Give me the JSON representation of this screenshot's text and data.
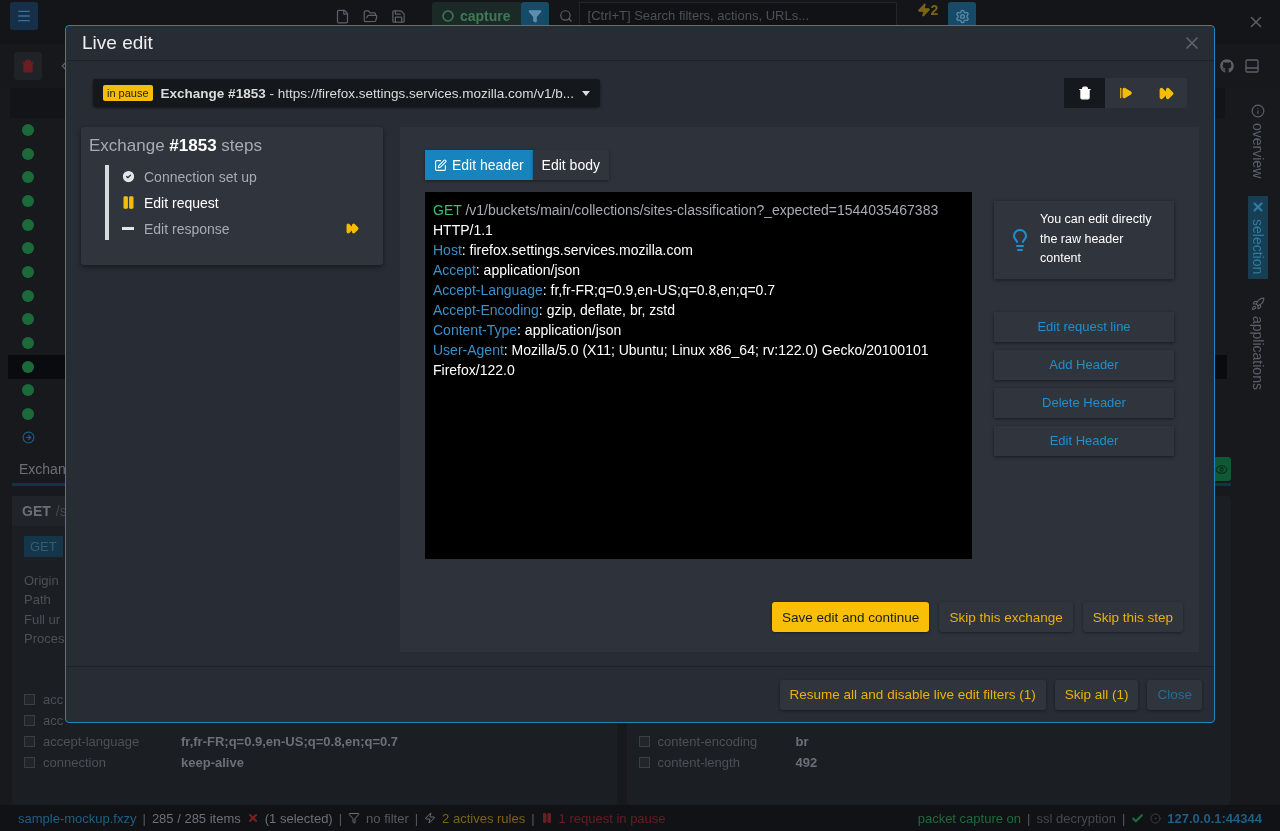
{
  "toolbar": {
    "capture_label": "capture",
    "search_placeholder": "[Ctrl+T] Search filters, actions, URLs...",
    "rules_count": "2"
  },
  "exchange_list": [
    {
      "kind": "dot",
      "selected": false
    },
    {
      "kind": "dot",
      "selected": false
    },
    {
      "kind": "dot",
      "selected": false
    },
    {
      "kind": "dot",
      "selected": false
    },
    {
      "kind": "dot",
      "selected": false
    },
    {
      "kind": "dot",
      "selected": false
    },
    {
      "kind": "dot",
      "selected": false
    },
    {
      "kind": "dot",
      "selected": false
    },
    {
      "kind": "dot",
      "selected": false
    },
    {
      "kind": "dot",
      "selected": false
    },
    {
      "kind": "dot",
      "selected": true
    },
    {
      "kind": "dot",
      "selected": false
    },
    {
      "kind": "dot",
      "selected": false
    },
    {
      "kind": "arrow",
      "selected": false
    }
  ],
  "detail_panel": {
    "tab": "Exchan",
    "summary_method": "GET",
    "summary_path": "/s",
    "method_badge": "GET",
    "labels": [
      "Origin",
      "Path",
      "Full ur",
      "Proces"
    ],
    "headers": [
      {
        "name": "acc",
        "checked": false
      },
      {
        "name": "acc",
        "checked": false
      },
      {
        "name": "accept-language",
        "value": "fr,fr-FR;q=0.9,en-US;q=0.8,en;q=0.7",
        "checked": false
      },
      {
        "name": "connection",
        "value": "keep-alive",
        "checked": false
      }
    ]
  },
  "response_panel": {
    "headers": [
      {
        "name": "content-encoding",
        "value": "br",
        "checked": false
      },
      {
        "name": "content-length",
        "value": "492",
        "checked": false
      }
    ]
  },
  "side_tabs": [
    {
      "label": "overview",
      "kind": "info",
      "selected": false
    },
    {
      "label": "selection",
      "kind": "cross",
      "selected": true
    },
    {
      "label": "applications",
      "kind": "rocket",
      "selected": false
    }
  ],
  "status_bar": {
    "separator": "|",
    "left": [
      {
        "kind": "file",
        "text": "sample-mockup.fxzy"
      },
      {
        "kind": "items",
        "text": "285 / 285 items"
      },
      {
        "kind": "selection",
        "text": "(1 selected)"
      },
      {
        "kind": "filter",
        "text": "no filter"
      },
      {
        "kind": "rules",
        "text": "2 actives rules"
      },
      {
        "kind": "pause",
        "text": "1 request in pause"
      }
    ],
    "right": [
      {
        "kind": "capture",
        "text": "packet capture on"
      },
      {
        "kind": "ssl",
        "text": "ssl decryption"
      },
      {
        "kind": "proxy",
        "text": "127.0.0.1:44344"
      }
    ]
  },
  "live_edit": {
    "title": "Live edit",
    "exchange_select": {
      "badge": "in pause",
      "label": "**Exchange #1853** - https://firefox.settings.services.mozilla.com/v1/b..."
    },
    "actions": [
      {
        "kind": "delete"
      },
      {
        "kind": "step"
      },
      {
        "kind": "resume"
      }
    ],
    "steps_title": "Exchange **#1853** steps",
    "steps": [
      {
        "label": "Connection set up",
        "kind": "done",
        "skip_marker": false
      },
      {
        "label": "Edit request",
        "kind": "paused",
        "skip_marker": false
      },
      {
        "label": "Edit response",
        "kind": "pending",
        "skip_marker": true
      }
    ],
    "header_separator": ":",
    "editor_tabs": [
      {
        "label": "Edit header",
        "selected": true
      },
      {
        "label": "Edit body",
        "selected": false
      }
    ],
    "request_line": {
      "method": "GET",
      "target": "/v1/buckets/main/collections/sites-classification?_expected=1544035467383",
      "version": "HTTP/1.1"
    },
    "headers": [
      {
        "name": "Host",
        "value": "firefox.settings.services.mozilla.com"
      },
      {
        "name": "Accept",
        "value": "application/json"
      },
      {
        "name": "Accept-Language",
        "value": "fr,fr-FR;q=0.9,en-US;q=0.8,en;q=0.7"
      },
      {
        "name": "Accept-Encoding",
        "value": "gzip, deflate, br, zstd"
      },
      {
        "name": "Content-Type",
        "value": "application/json"
      },
      {
        "name": "User-Agent",
        "value": "Mozilla/5.0 (X11; Ubuntu; Linux x86_64; rv:122.0) Gecko/20100101 Firefox/122.0"
      }
    ],
    "tip": "You can edit directly the raw header content",
    "header_actions": [
      "Edit request line",
      "Add Header",
      "Delete Header",
      "Edit Header"
    ],
    "step_actions": [
      {
        "label": "Save edit and continue",
        "primary": true
      },
      {
        "label": "Skip this exchange",
        "primary": false
      },
      {
        "label": "Skip this step",
        "primary": false
      }
    ],
    "footer_actions": [
      {
        "label": "Resume all and disable live edit filters (1)",
        "kind": "warning"
      },
      {
        "label": "Skip all (1)",
        "kind": "warning"
      },
      {
        "label": "Close",
        "kind": "link"
      }
    ]
  }
}
